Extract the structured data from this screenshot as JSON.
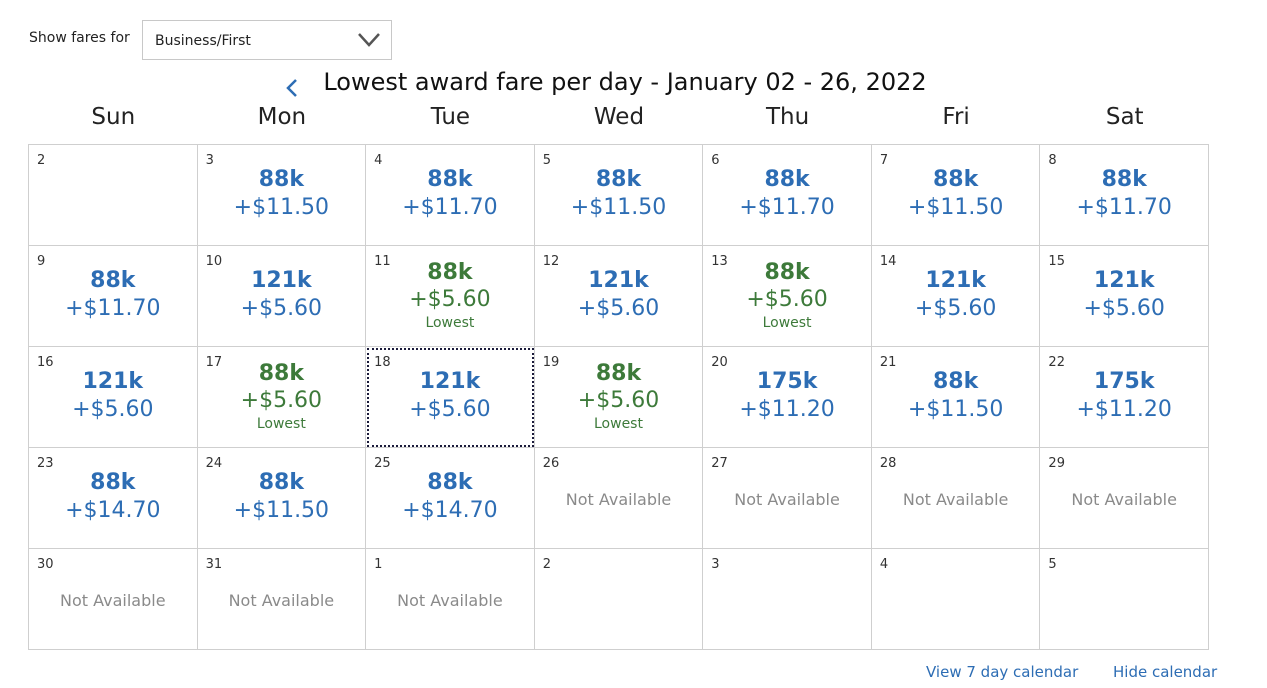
{
  "filter": {
    "label": "Show fares for",
    "selected": "Business/First"
  },
  "calendar": {
    "title": "Lowest award fare per day - January 02 - 26, 2022",
    "weekdays": [
      "Sun",
      "Mon",
      "Tue",
      "Wed",
      "Thu",
      "Fri",
      "Sat"
    ],
    "lowest_label": "Lowest",
    "not_available_label": "Not Available",
    "selected_day": "18",
    "days": [
      {
        "day": "2",
        "status": "empty"
      },
      {
        "day": "3",
        "status": "fare",
        "miles": "88k",
        "tax": "+$11.50"
      },
      {
        "day": "4",
        "status": "fare",
        "miles": "88k",
        "tax": "+$11.70"
      },
      {
        "day": "5",
        "status": "fare",
        "miles": "88k",
        "tax": "+$11.50"
      },
      {
        "day": "6",
        "status": "fare",
        "miles": "88k",
        "tax": "+$11.70"
      },
      {
        "day": "7",
        "status": "fare",
        "miles": "88k",
        "tax": "+$11.50"
      },
      {
        "day": "8",
        "status": "fare",
        "miles": "88k",
        "tax": "+$11.70"
      },
      {
        "day": "9",
        "status": "fare",
        "miles": "88k",
        "tax": "+$11.70"
      },
      {
        "day": "10",
        "status": "fare",
        "miles": "121k",
        "tax": "+$5.60"
      },
      {
        "day": "11",
        "status": "lowest",
        "miles": "88k",
        "tax": "+$5.60"
      },
      {
        "day": "12",
        "status": "fare",
        "miles": "121k",
        "tax": "+$5.60"
      },
      {
        "day": "13",
        "status": "lowest",
        "miles": "88k",
        "tax": "+$5.60"
      },
      {
        "day": "14",
        "status": "fare",
        "miles": "121k",
        "tax": "+$5.60"
      },
      {
        "day": "15",
        "status": "fare",
        "miles": "121k",
        "tax": "+$5.60"
      },
      {
        "day": "16",
        "status": "fare",
        "miles": "121k",
        "tax": "+$5.60"
      },
      {
        "day": "17",
        "status": "lowest",
        "miles": "88k",
        "tax": "+$5.60"
      },
      {
        "day": "18",
        "status": "fare",
        "miles": "121k",
        "tax": "+$5.60"
      },
      {
        "day": "19",
        "status": "lowest",
        "miles": "88k",
        "tax": "+$5.60"
      },
      {
        "day": "20",
        "status": "fare",
        "miles": "175k",
        "tax": "+$11.20"
      },
      {
        "day": "21",
        "status": "fare",
        "miles": "88k",
        "tax": "+$11.50"
      },
      {
        "day": "22",
        "status": "fare",
        "miles": "175k",
        "tax": "+$11.20"
      },
      {
        "day": "23",
        "status": "fare",
        "miles": "88k",
        "tax": "+$14.70"
      },
      {
        "day": "24",
        "status": "fare",
        "miles": "88k",
        "tax": "+$11.50"
      },
      {
        "day": "25",
        "status": "fare",
        "miles": "88k",
        "tax": "+$14.70"
      },
      {
        "day": "26",
        "status": "na"
      },
      {
        "day": "27",
        "status": "na"
      },
      {
        "day": "28",
        "status": "na"
      },
      {
        "day": "29",
        "status": "na"
      },
      {
        "day": "30",
        "status": "na"
      },
      {
        "day": "31",
        "status": "na"
      },
      {
        "day": "1",
        "status": "na"
      },
      {
        "day": "2",
        "status": "empty"
      },
      {
        "day": "3",
        "status": "empty"
      },
      {
        "day": "4",
        "status": "empty"
      },
      {
        "day": "5",
        "status": "empty"
      }
    ]
  },
  "links": {
    "view_7_day": "View 7 day calendar",
    "hide": "Hide calendar"
  },
  "colors": {
    "fare": "#2d6db4",
    "lowest": "#3d7a3a",
    "unavailable": "#8a8a8a",
    "grid_border": "#cfcfcf"
  },
  "icons": {
    "select_arrow": "chevron-down-icon",
    "prev_month": "chevron-left-icon"
  }
}
